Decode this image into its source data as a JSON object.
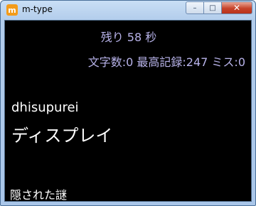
{
  "window": {
    "title": "m-type",
    "icon": "m-type-app-icon",
    "icon_letter": "m",
    "controls": {
      "minimize": "minimize",
      "maximize": "maximize",
      "close": "close"
    }
  },
  "game": {
    "time_remaining": "残り 58 秒",
    "stats": "文字数:0 最高記録:247 ミス:0",
    "romaji": "dhisupurei",
    "word": "ディスプレイ",
    "song_title": "隠された謎"
  },
  "colors": {
    "background": "#000000",
    "status_text": "#b8b3ea",
    "main_text": "#ffffff",
    "app_icon": "#f39b1a",
    "close_button": "#c7432b"
  }
}
